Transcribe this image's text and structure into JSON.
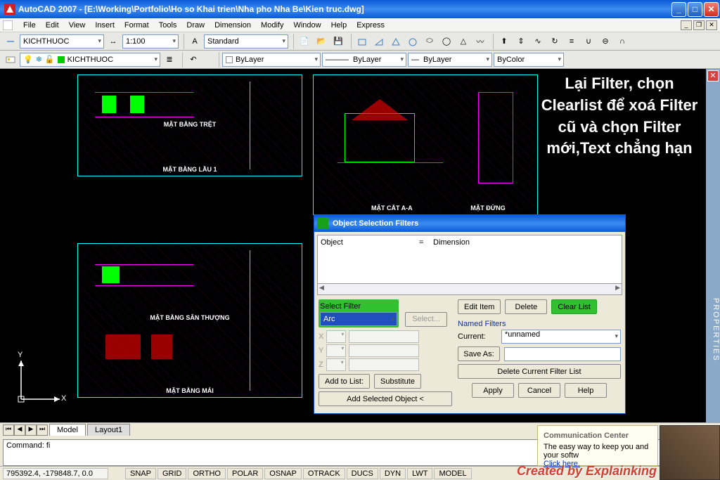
{
  "titlebar": {
    "text": "AutoCAD 2007 - [E:\\Working\\Portfolio\\Ho so Khai trien\\Nha pho Nha Be\\Kien truc.dwg]"
  },
  "menu": {
    "file": "File",
    "edit": "Edit",
    "view": "View",
    "insert": "Insert",
    "format": "Format",
    "tools": "Tools",
    "draw": "Draw",
    "dimension": "Dimension",
    "modify": "Modify",
    "window": "Window",
    "help": "Help",
    "express": "Express"
  },
  "tb1": {
    "dim_style": "KICHTHUOC",
    "scale": "1:100",
    "text_style": "Standard"
  },
  "layers": {
    "current": "KICHTHUOC",
    "bylayer": "ByLayer",
    "bycolor": "ByColor"
  },
  "properties_tab": "PROPERTIES",
  "annotation": "Lại Filter, chọn Clearlist để xoá Filter cũ và chọn Filter mới,Text chẳng hạn",
  "drawing_labels": {
    "l1": "MẶT BẰNG TRỆT",
    "l2": "MẶT BẰNG LẦU 1",
    "l3": "MẶT BẰNG SÂN THƯỢNG",
    "l4": "MẶT BẰNG MÁI",
    "l5": "MẶT CẮT A-A",
    "l6": "MẶT ĐỨNG"
  },
  "ucs": {
    "x": "X",
    "y": "Y"
  },
  "dialog": {
    "title": "Object Selection Filters",
    "list": {
      "col1": "Object",
      "eq": "=",
      "col2": "Dimension"
    },
    "select_filter": "Select Filter",
    "arc": "Arc",
    "select_btn": "Select...",
    "xl": "X",
    "yl": "Y",
    "zl": "Z",
    "add_to_list": "Add to List:",
    "substitute": "Substitute",
    "add_selected": "Add Selected Object <",
    "edit_item": "Edit Item",
    "delete": "Delete",
    "clear_list": "Clear List",
    "named_filters": "Named Filters",
    "current": "Current:",
    "current_val": "*unnamed",
    "save_as": "Save As:",
    "save_val": "",
    "delete_list": "Delete Current Filter List",
    "apply": "Apply",
    "cancel": "Cancel",
    "help": "Help"
  },
  "tabs": {
    "model": "Model",
    "layout": "Layout1"
  },
  "command": {
    "prompt": "Command: ",
    "value": "fi"
  },
  "status": {
    "coord": "795392.4, -179848.7, 0.0",
    "snap": "SNAP",
    "grid": "GRID",
    "ortho": "ORTHO",
    "polar": "POLAR",
    "osnap": "OSNAP",
    "otrack": "OTRACK",
    "ducs": "DUCS",
    "dyn": "DYN",
    "lwt": "LWT",
    "model": "MODEL"
  },
  "comm_center": {
    "title": "Communication Center",
    "text": "The easy way to keep you and your softw",
    "link": "Click here."
  },
  "watermark": "Created by Explainking"
}
